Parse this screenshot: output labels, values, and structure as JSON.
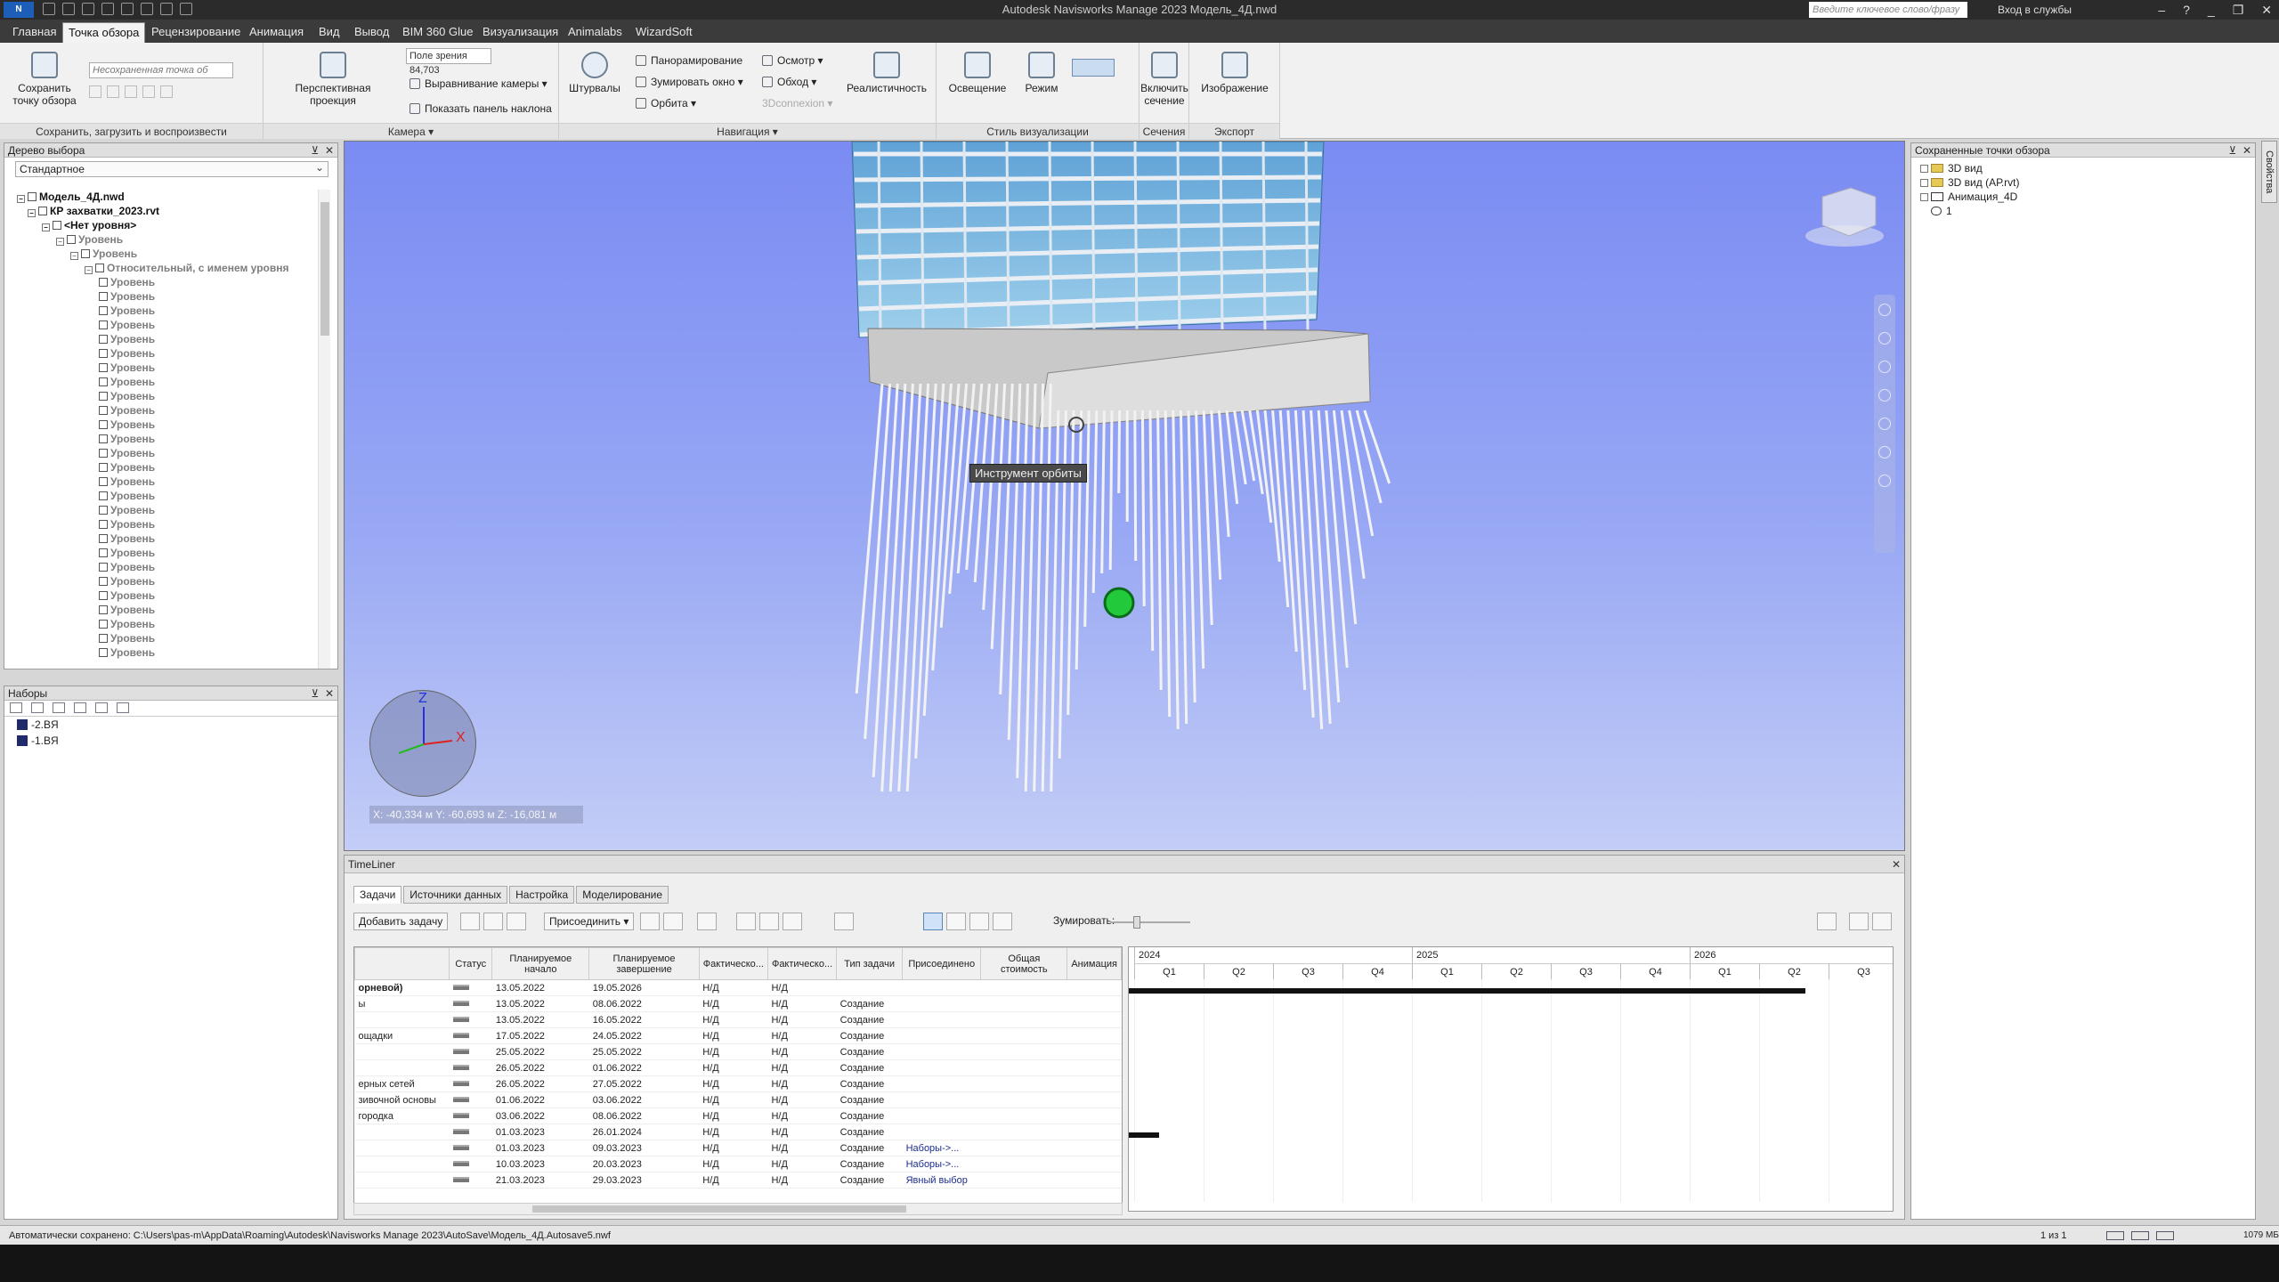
{
  "title": {
    "app_logo": "N",
    "window_title": "Autodesk Navisworks Manage 2023   Модель_4Д.nwd",
    "search_placeholder": "Введите ключевое слово/фразу",
    "login": "Вход в службы"
  },
  "menu": {
    "tabs": [
      "Главная",
      "Точка обзора",
      "Рецензирование",
      "Анимация",
      "Вид",
      "Вывод",
      "BIM 360 Glue",
      "Визуализация",
      "Animalabs",
      "WizardSoft"
    ],
    "active": "Точка обзора"
  },
  "ribbon": {
    "save_viewpoint": "Сохранить точку обзора",
    "viewpoint_input": "Несохраненная точка об",
    "group_save": "Сохранить, загрузить и воспроизвести",
    "perspective": "Перспективная проекция",
    "field_label": "Поле зрения",
    "field_value": "84,703",
    "align_camera": "Выравнивание камеры",
    "show_tilt": "Показать панель наклона",
    "group_camera": "Камера",
    "steering": "Штурвалы",
    "pan": "Панорамирование",
    "zoom_window": "Зумировать окно",
    "orbit": "Орбита",
    "look": "Осмотр",
    "walk": "Обход",
    "connexion": "3Dconnexion",
    "realism": "Реалистичность",
    "group_nav": "Навигация",
    "lighting": "Освещение",
    "mode": "Режим",
    "group_style": "Стиль визуализации",
    "enable_section": "Включить сечение",
    "group_section": "Сечения",
    "image": "Изображение",
    "group_export": "Экспорт"
  },
  "selection_tree": {
    "title": "Дерево выбора",
    "mode": "Стандартное",
    "root": "Модель_4Д.nwd",
    "file": "КР захватки_2023.rvt",
    "no_level": "<Нет уровня>",
    "level_a": "Уровень",
    "level_b": "Уровень",
    "relative": "Относительный, с именем уровня",
    "items": [
      "Уровень",
      "Уровень",
      "Уровень",
      "Уровень",
      "Уровень",
      "Уровень",
      "Уровень",
      "Уровень",
      "Уровень",
      "Уровень",
      "Уровень",
      "Уровень",
      "Уровень",
      "Уровень",
      "Уровень",
      "Уровень",
      "Уровень",
      "Уровень",
      "Уровень",
      "Уровень",
      "Уровень",
      "Уровень",
      "Уровень",
      "Уровень",
      "Уровень",
      "Уровень",
      "Уровень"
    ]
  },
  "sets": {
    "title": "Наборы",
    "items": [
      "-2.BЯ",
      "-1.BЯ"
    ]
  },
  "viewport": {
    "tooltip": "Инструмент орбиты",
    "coords": "X: -40,334 м  Y: -60,693 м  Z: -16,081 м",
    "axis_z": "Z",
    "axis_x": "X"
  },
  "saved_viewpoints": {
    "title": "Сохраненные точки обзора",
    "items": [
      "3D вид",
      "3D вид (АР.rvt)",
      "Анимация_4D",
      "1"
    ]
  },
  "properties_tab": "Свойства",
  "timeliner": {
    "title": "TimeLiner",
    "tabs": [
      "Задачи",
      "Источники данных",
      "Настройка",
      "Моделирование"
    ],
    "add_task": "Добавить задачу",
    "attach": "Присоединить",
    "zoom_label": "Зумировать:",
    "columns": [
      "",
      "Статус",
      "Планируемое начало",
      "Планируемое завершение",
      "Фактическо...",
      "Фактическо...",
      "Тип задачи",
      "Присоединено",
      "Общая стоимость",
      "Анимация"
    ],
    "rows": [
      {
        "name": "орневой)",
        "start": "13.05.2022",
        "end": "19.05.2026",
        "f1": "Н/Д",
        "f2": "Н/Д",
        "type": "",
        "att": ""
      },
      {
        "name": "ы",
        "start": "13.05.2022",
        "end": "08.06.2022",
        "f1": "Н/Д",
        "f2": "Н/Д",
        "type": "Создание",
        "att": ""
      },
      {
        "name": "",
        "start": "13.05.2022",
        "end": "16.05.2022",
        "f1": "Н/Д",
        "f2": "Н/Д",
        "type": "Создание",
        "att": ""
      },
      {
        "name": "ощадки",
        "start": "17.05.2022",
        "end": "24.05.2022",
        "f1": "Н/Д",
        "f2": "Н/Д",
        "type": "Создание",
        "att": ""
      },
      {
        "name": "",
        "start": "25.05.2022",
        "end": "25.05.2022",
        "f1": "Н/Д",
        "f2": "Н/Д",
        "type": "Создание",
        "att": ""
      },
      {
        "name": "",
        "start": "26.05.2022",
        "end": "01.06.2022",
        "f1": "Н/Д",
        "f2": "Н/Д",
        "type": "Создание",
        "att": ""
      },
      {
        "name": "ерных сетей",
        "start": "26.05.2022",
        "end": "27.05.2022",
        "f1": "Н/Д",
        "f2": "Н/Д",
        "type": "Создание",
        "att": ""
      },
      {
        "name": "зивочной основы",
        "start": "01.06.2022",
        "end": "03.06.2022",
        "f1": "Н/Д",
        "f2": "Н/Д",
        "type": "Создание",
        "att": ""
      },
      {
        "name": "городка",
        "start": "03.06.2022",
        "end": "08.06.2022",
        "f1": "Н/Д",
        "f2": "Н/Д",
        "type": "Создание",
        "att": ""
      },
      {
        "name": "",
        "start": "01.03.2023",
        "end": "26.01.2024",
        "f1": "Н/Д",
        "f2": "Н/Д",
        "type": "Создание",
        "att": ""
      },
      {
        "name": "",
        "start": "01.03.2023",
        "end": "09.03.2023",
        "f1": "Н/Д",
        "f2": "Н/Д",
        "type": "Создание",
        "att": "Наборы->..."
      },
      {
        "name": "",
        "start": "10.03.2023",
        "end": "20.03.2023",
        "f1": "Н/Д",
        "f2": "Н/Д",
        "type": "Создание",
        "att": "Наборы->..."
      },
      {
        "name": "",
        "start": "21.03.2023",
        "end": "29.03.2023",
        "f1": "Н/Д",
        "f2": "Н/Д",
        "type": "Создание",
        "att": "Явный выбор"
      }
    ],
    "gantt_years": [
      "2024",
      "2025",
      "2026"
    ],
    "gantt_quarters": [
      "Q1",
      "Q2",
      "Q3",
      "Q4",
      "Q1",
      "Q2",
      "Q3",
      "Q4",
      "Q1",
      "Q2",
      "Q3"
    ]
  },
  "statusbar": {
    "autosave": "Автоматически сохранено: C:\\Users\\pas-m\\AppData\\Roaming\\Autodesk\\Navisworks Manage 2023\\AutoSave\\Модель_4Д.Autosave5.nwf",
    "pager": "1 из 1",
    "memory": "1079 МБ"
  }
}
